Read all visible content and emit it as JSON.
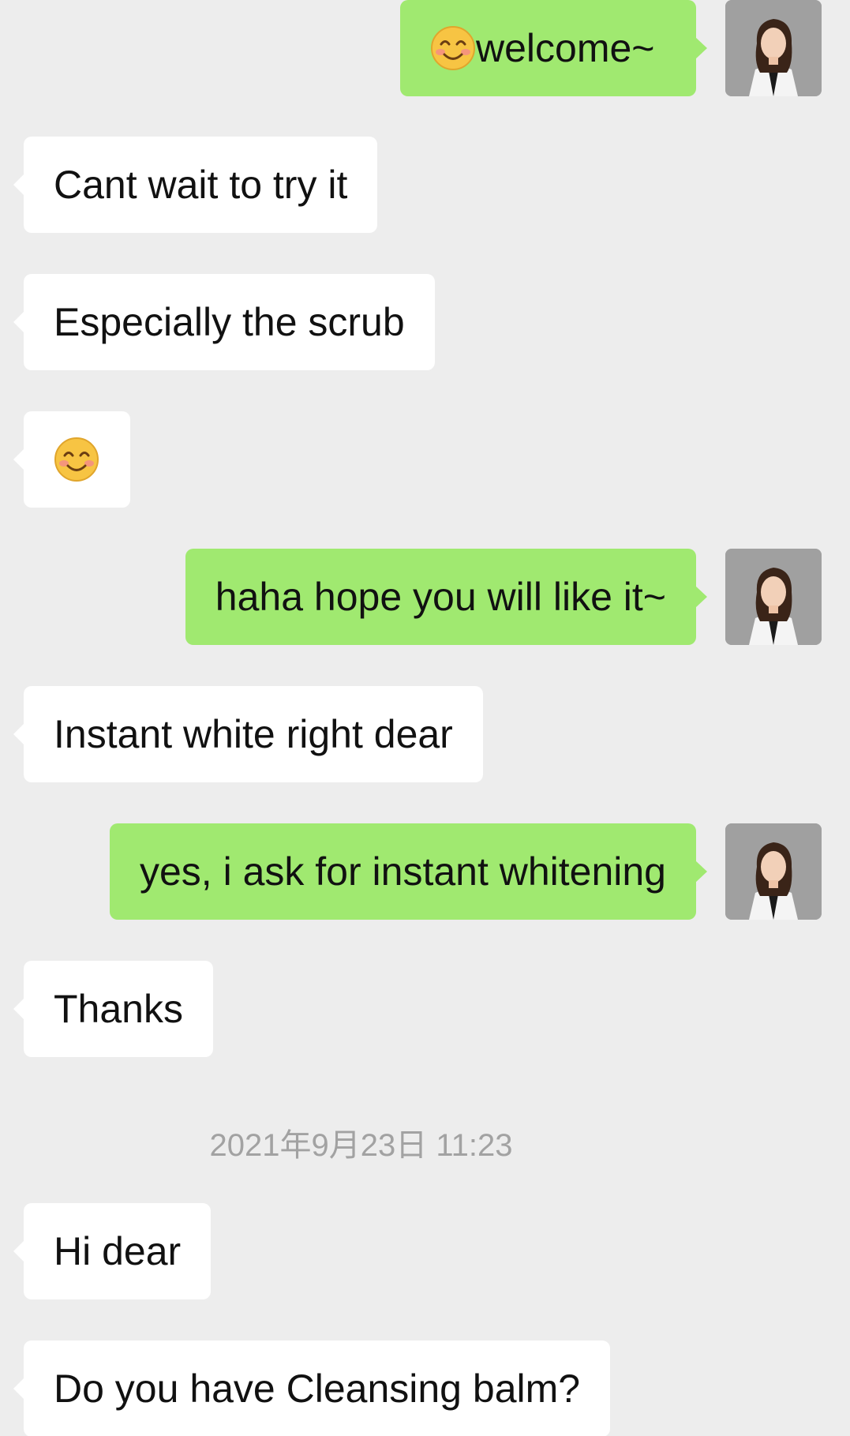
{
  "messages": [
    {
      "side": "out",
      "emoji": "smiling-face-icon",
      "text": "welcome~"
    },
    {
      "side": "in",
      "text": "Cant wait to try it"
    },
    {
      "side": "in",
      "text": "Especially the scrub"
    },
    {
      "side": "in",
      "emoji": "smiling-face-icon",
      "text": ""
    },
    {
      "side": "out",
      "text": "haha hope you will like it~"
    },
    {
      "side": "in",
      "text": "Instant white right dear"
    },
    {
      "side": "out",
      "text": "yes, i ask for instant whitening"
    },
    {
      "side": "in",
      "text": "Thanks"
    },
    {
      "side": "in",
      "text": "Hi dear"
    },
    {
      "side": "in",
      "text": "Do you have Cleansing balm?"
    }
  ],
  "timestamp": "2021年9月23日 11:23",
  "colors": {
    "background": "#ededed",
    "outgoing_bubble": "#a0e970",
    "incoming_bubble": "#ffffff",
    "timestamp_text": "#a2a2a2"
  }
}
